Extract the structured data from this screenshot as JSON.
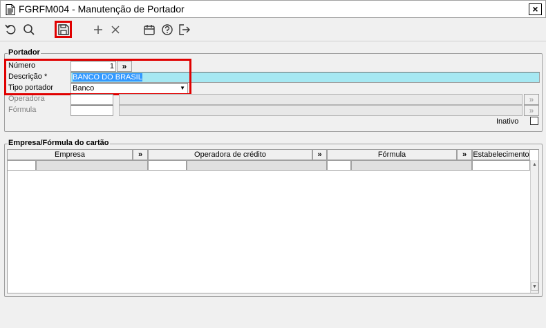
{
  "window": {
    "title": "FGRFM004 - Manutenção de Portador",
    "close_label": "×"
  },
  "toolbar": {
    "icons": [
      "undo-icon",
      "search-icon",
      "save-icon",
      "add-icon",
      "delete-icon",
      "calendar-icon",
      "help-icon",
      "exit-icon"
    ]
  },
  "portador": {
    "legend": "Portador",
    "numero": {
      "label": "Número",
      "value": "1",
      "lookup": "»"
    },
    "descricao": {
      "label": "Descrição *",
      "value": "BANCO DO BRASIL"
    },
    "tipo": {
      "label": "Tipo portador",
      "value": "Banco"
    },
    "operadora": {
      "label": "Operadora",
      "lookup": "»"
    },
    "formula": {
      "label": "Fórmula",
      "lookup": "»"
    },
    "inativo": {
      "label": "Inativo"
    }
  },
  "empresa_formula": {
    "legend": "Empresa/Fórmula do cartão",
    "columns": [
      {
        "label": "Empresa",
        "lookup": "»"
      },
      {
        "label": "Operadora de crédito",
        "lookup": "»"
      },
      {
        "label": "Fórmula",
        "lookup": "»"
      },
      {
        "label": "Estabelecimento"
      }
    ]
  },
  "colors": {
    "highlight": "#e00000",
    "selection": "#3399ff",
    "description_bg": "#a6e8f2"
  }
}
